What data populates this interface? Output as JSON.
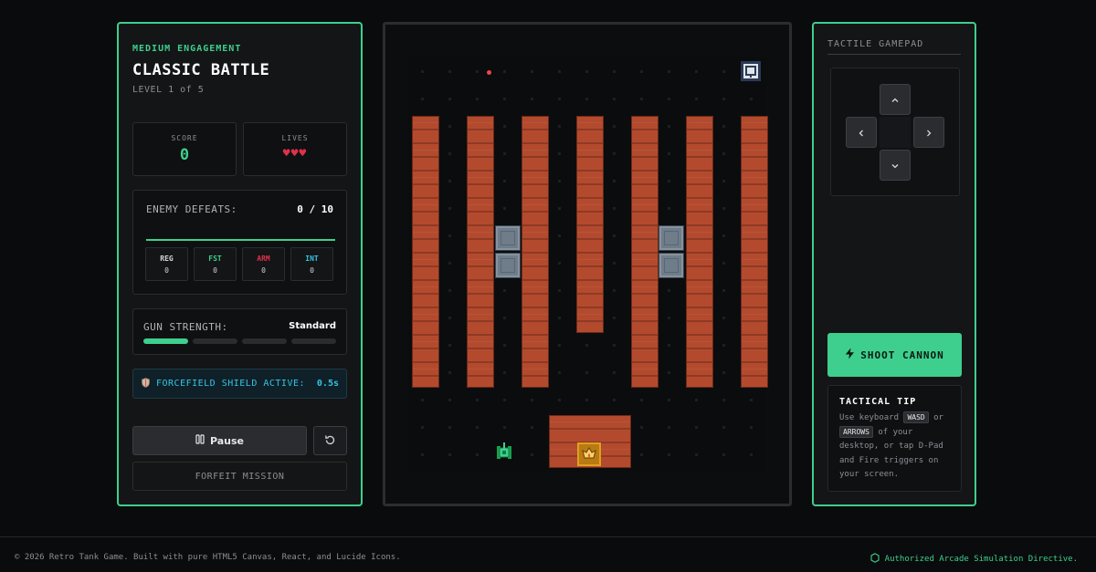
{
  "game": {
    "difficulty": "MEDIUM ENGAGEMENT",
    "mode_title": "CLASSIC BATTLE",
    "level_text": "LEVEL 1 of 5",
    "score_label": "SCORE",
    "score": "0",
    "lives_label": "LIVES",
    "lives_hearts": "❤️❤️❤️",
    "lives_count": 3
  },
  "defeats": {
    "label": "ENEMY DEFEATS:",
    "value": "0 / 10",
    "progress": 0,
    "types": [
      {
        "name": "REG",
        "count": "0",
        "color": "#d4d7db"
      },
      {
        "name": "FST",
        "count": "0",
        "color": "#3ecf8e"
      },
      {
        "name": "ARM",
        "count": "0",
        "color": "#e0314b"
      },
      {
        "name": "INT",
        "count": "0",
        "color": "#34c4e3"
      }
    ]
  },
  "gun": {
    "label": "GUN STRENGTH:",
    "value": "Standard",
    "level": 1,
    "max_level": 4
  },
  "shield": {
    "label": "FORCEFIELD SHIELD ACTIVE:",
    "value": "0.5s"
  },
  "controls": {
    "pause_label": "Pause",
    "forfeit_label": "FORFEIT MISSION"
  },
  "gamepad": {
    "title": "TACTILE GAMEPAD",
    "shoot_label": "SHOOT CANNON"
  },
  "tip": {
    "title": "TACTICAL TIP",
    "text_1": "Use keyboard",
    "key_1": "WASD",
    "text_2": "or",
    "key_2": "ARROWS",
    "text_3": "of your desktop, or tap D-Pad and Fire triggers on your screen."
  },
  "footer": {
    "left": "© 2026 Retro Tank Game. Built with pure HTML5 Canvas, React, and Lucide Icons.",
    "right": "Authorized Arcade Simulation Directive."
  },
  "colors": {
    "accent": "#3ecf8e",
    "shield": "#34c4e3",
    "brick": "#b34a2e",
    "steel": "#6f7c89",
    "base": "#b97a12"
  },
  "icons": [
    "shield-icon",
    "pause-icon",
    "restart-icon",
    "arrow-up-icon",
    "arrow-left-icon",
    "arrow-right-icon",
    "arrow-down-icon",
    "lightning-icon",
    "hexagon-icon",
    "heart-icon",
    "player-tank-icon",
    "eagle-base-icon",
    "enemy-tank-icon"
  ]
}
